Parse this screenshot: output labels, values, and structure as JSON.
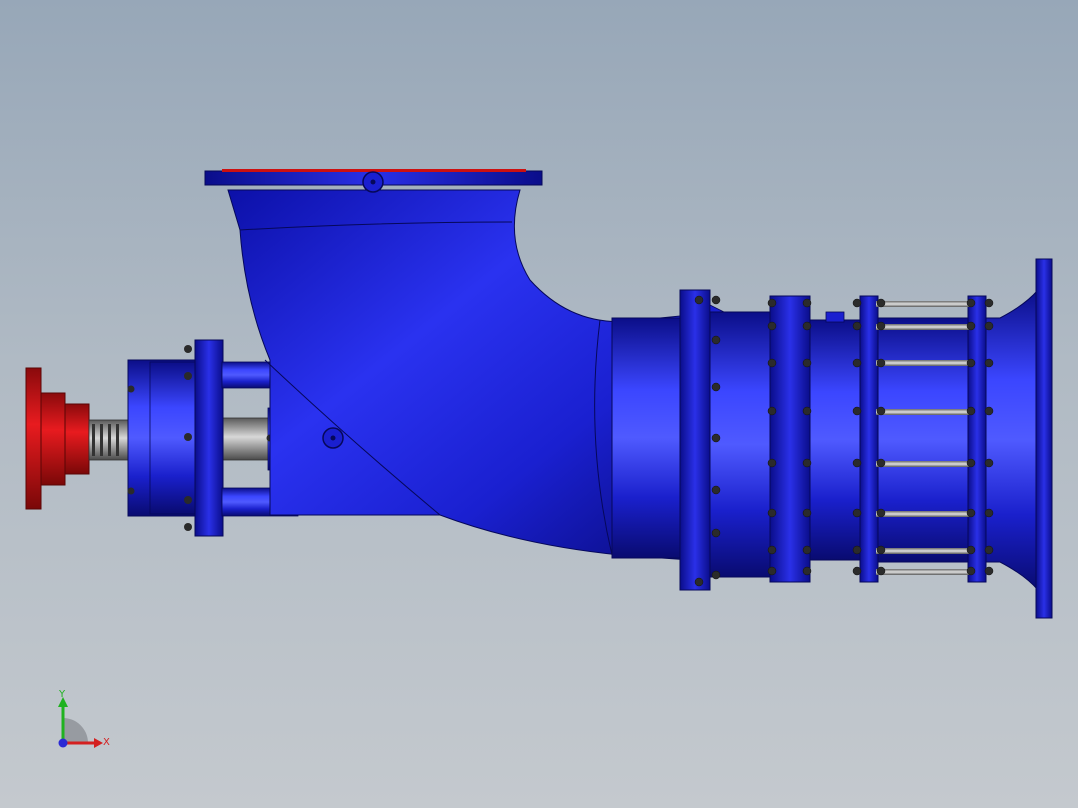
{
  "viewport": {
    "background_top": "#97a7b8",
    "background_bottom": "#c4c9ce"
  },
  "model": {
    "body_color": "#1a1fd6",
    "flange_color": "#1414b8",
    "coupling_color": "#d10f14",
    "shaft_color": "#9a9a9a",
    "bolt_color": "#2a2a2a"
  },
  "triad": {
    "x_label": "X",
    "y_label": "Y",
    "x_color": "#d42020",
    "y_color": "#1fb21f",
    "z_color": "#2a2ad4"
  }
}
